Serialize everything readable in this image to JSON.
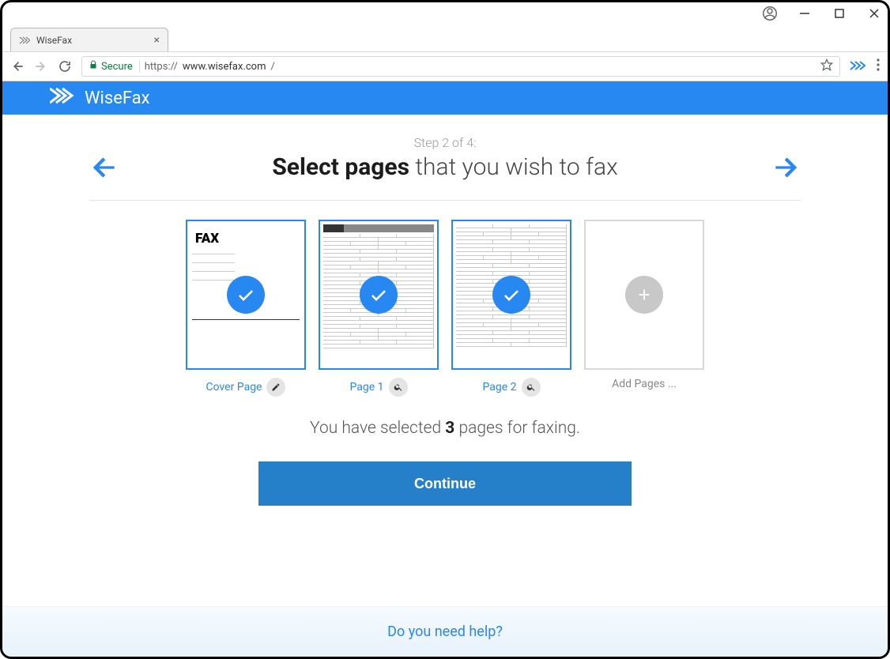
{
  "browser": {
    "tab_title": "WiseFax",
    "secure_label": "Secure",
    "url_scheme": "https://",
    "url_host": "www.wisefax.com",
    "url_path": "/"
  },
  "brand": {
    "name": "WiseFax"
  },
  "step": {
    "label": "Step 2 of 4:",
    "heading_bold": "Select pages",
    "heading_rest": " that you wish to fax"
  },
  "thumbs": {
    "cover_fax_text": "FAX",
    "cover_label": "Cover Page",
    "page1_label": "Page 1",
    "page2_label": "Page 2",
    "add_label": "Add Pages ..."
  },
  "summary": {
    "prefix": "You have selected ",
    "count": "3",
    "suffix": " pages for faxing."
  },
  "actions": {
    "continue": "Continue",
    "help": "Do you need help?"
  }
}
